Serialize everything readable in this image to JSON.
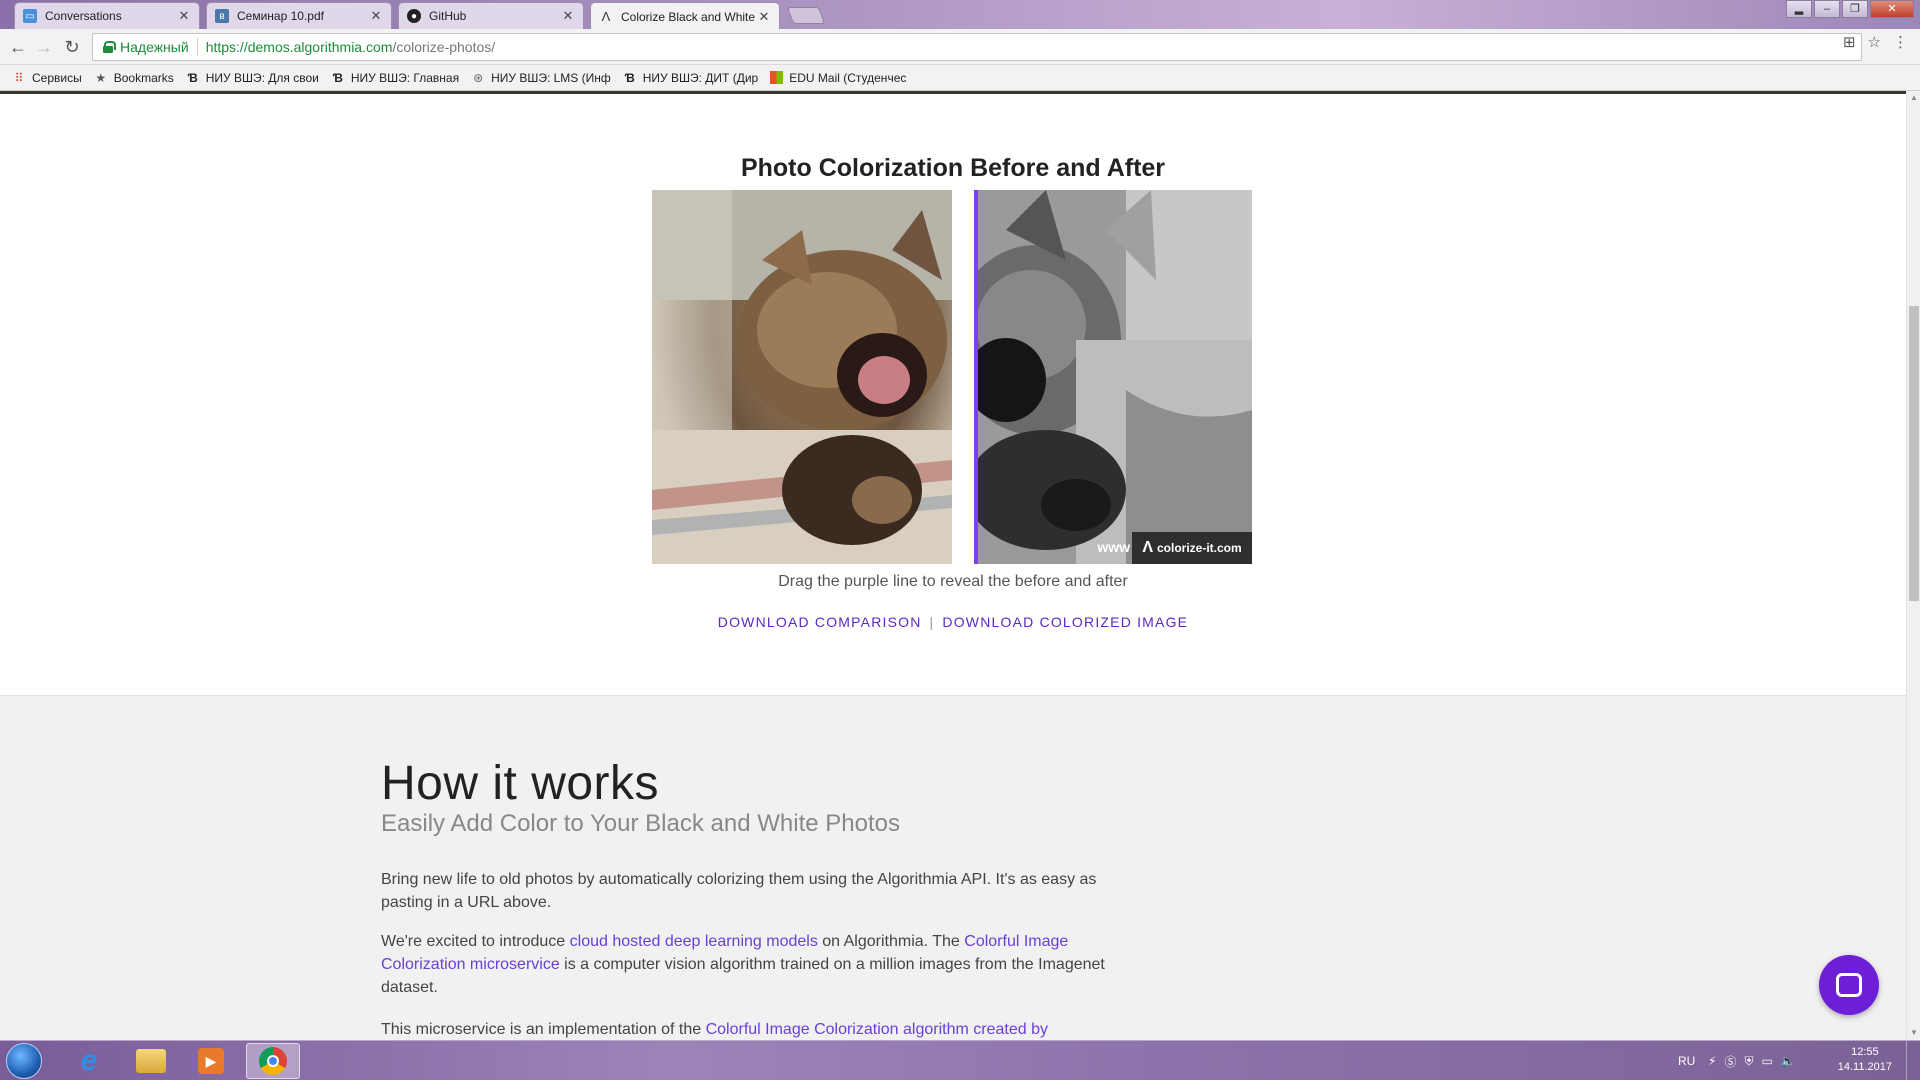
{
  "browser": {
    "tabs": [
      {
        "title": "Conversations",
        "icon": "conversations-icon",
        "color": "#4a90d9",
        "active": false
      },
      {
        "title": "Семинар 10.pdf",
        "icon": "vk-icon",
        "color": "#4a76a8",
        "active": false
      },
      {
        "title": "GitHub",
        "icon": "github-icon",
        "color": "#222222",
        "active": false
      },
      {
        "title": "Colorize Black and White",
        "icon": "algorithmia-icon",
        "color": "#333333",
        "active": true
      }
    ],
    "secure_label": "Надежный",
    "url_host": "https://demos.algorithmia.com",
    "url_path": "/colorize-photos/",
    "bookmarks": [
      {
        "label": "Сервисы",
        "icon": "apps-grid-icon"
      },
      {
        "label": "Bookmarks",
        "icon": "star-icon"
      },
      {
        "label": "НИУ ВШЭ: Для свои",
        "icon": "hse-icon"
      },
      {
        "label": "НИУ ВШЭ: Главная",
        "icon": "hse-icon"
      },
      {
        "label": "НИУ ВШЭ: LMS (Инф",
        "icon": "lms-icon"
      },
      {
        "label": "НИУ ВШЭ: ДИТ (Дир",
        "icon": "hse-icon"
      },
      {
        "label": "EDU Mail (Студенчес",
        "icon": "windows-logo-icon"
      }
    ]
  },
  "page": {
    "comparison_title": "Photo Colorization Before and After",
    "watermark_www": "www",
    "watermark_site": "colorize-it.com",
    "caption": "Drag the purple line to reveal the before and after",
    "download_comparison": "DOWNLOAD COMPARISON",
    "download_colorized": "DOWNLOAD COLORIZED IMAGE",
    "divider_color": "#7b3ff2",
    "accent_color": "#5b2ac4",
    "how_title": "How it works",
    "how_subtitle": "Easily Add Color to Your Black and White Photos",
    "para1": "Bring new life to old photos by automatically colorizing them using the Algorithmia API. It's as easy as pasting in a URL above.",
    "para2_a": "We're excited to introduce ",
    "para2_link1": "cloud hosted deep learning models",
    "para2_b": " on Algorithmia. The ",
    "para2_link2": "Colorful Image Colorization microservice",
    "para2_c": " is a computer vision algorithm trained on a million images from the Imagenet dataset.",
    "para3_a": "This microservice is an implementation of the ",
    "para3_link": "Colorful Image Colorization algorithm created by"
  },
  "taskbar": {
    "language": "RU",
    "time": "12:55",
    "date": "14.11.2017",
    "apps": [
      "start-orb",
      "internet-explorer-icon",
      "file-explorer-icon",
      "media-player-icon",
      "chrome-icon"
    ]
  }
}
